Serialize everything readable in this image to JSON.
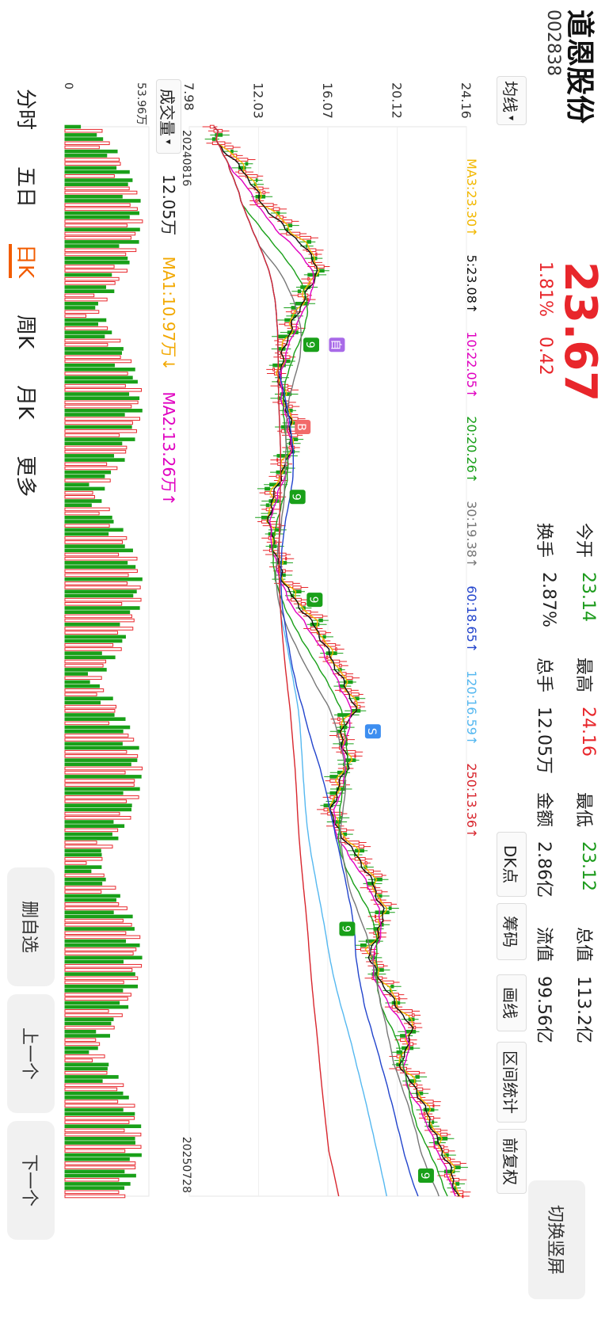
{
  "stock": {
    "name": "道恩股份",
    "code": "002838",
    "price": "23.67",
    "change_pct": "1.81%",
    "change": "0.42"
  },
  "stats": [
    {
      "label": "今开",
      "value": "23.14",
      "color": "green"
    },
    {
      "label": "最高",
      "value": "24.16",
      "color": "red"
    },
    {
      "label": "最低",
      "value": "23.12",
      "color": "green"
    },
    {
      "label": "总值",
      "value": "113.2亿",
      "color": "dark"
    },
    {
      "label": "换手",
      "value": "2.87%",
      "color": "dark"
    },
    {
      "label": "总手",
      "value": "12.05万",
      "color": "dark"
    },
    {
      "label": "金额",
      "value": "2.86亿",
      "color": "dark"
    },
    {
      "label": "流值",
      "value": "99.56亿",
      "color": "dark"
    }
  ],
  "switch_button": "切换竖屏",
  "controls": {
    "ma_select": "均线",
    "dk": "DK点",
    "chip": "筹码",
    "draw": "画线",
    "range": "区间统计",
    "adjust": "前复权"
  },
  "ma_legend": [
    {
      "text": "MA3:23.30↑",
      "color": "#f2b800"
    },
    {
      "text": "5:23.08↑",
      "color": "#111111"
    },
    {
      "text": "10:22.05↑",
      "color": "#e000c0"
    },
    {
      "text": "20:20.26↑",
      "color": "#19a019"
    },
    {
      "text": "30:19.38↑",
      "color": "#777777"
    },
    {
      "text": "60:18.65↑",
      "color": "#2244cc"
    },
    {
      "text": "120:16.59↑",
      "color": "#55b8f0"
    },
    {
      "text": "250:13.36↑",
      "color": "#d8262e"
    }
  ],
  "volume_bar": {
    "select": "成交量",
    "value": "12.05万",
    "ma1": "MA1:10.97万↓",
    "ma2": "MA2:13.26万↑",
    "ma1_color": "#f2a800",
    "ma2_color": "#e000c0"
  },
  "side_tabs": [
    "分时",
    "五日",
    "日K",
    "周K",
    "月K",
    "更多"
  ],
  "active_tab": "日K",
  "bottom_buttons": [
    "删自选",
    "上一个",
    "下一个"
  ],
  "colors": {
    "up": "#e8262b",
    "down": "#19a019",
    "accent": "#f25c00"
  },
  "chart_data": {
    "type": "candlestick",
    "y_ticks": [
      "24.16",
      "20.12",
      "16.07",
      "12.03",
      "7.98"
    ],
    "ylim": [
      7.98,
      24.16
    ],
    "x_start": "20240816",
    "x_end": "20250728",
    "volume_ticks": [
      "53.96万",
      "0"
    ],
    "close_path": [
      {
        "i": 0,
        "v": 9.2
      },
      {
        "i": 10,
        "v": 11.4
      },
      {
        "i": 18,
        "v": 12.4
      },
      {
        "i": 25,
        "v": 14.2
      },
      {
        "i": 32,
        "v": 15.6
      },
      {
        "i": 38,
        "v": 14.9
      },
      {
        "i": 45,
        "v": 14.1
      },
      {
        "i": 52,
        "v": 13.5
      },
      {
        "i": 60,
        "v": 13.2
      },
      {
        "i": 68,
        "v": 13.8
      },
      {
        "i": 76,
        "v": 14.0
      },
      {
        "i": 84,
        "v": 13.2
      },
      {
        "i": 92,
        "v": 12.6
      },
      {
        "i": 100,
        "v": 12.9
      },
      {
        "i": 110,
        "v": 13.6
      },
      {
        "i": 120,
        "v": 15.4
      },
      {
        "i": 130,
        "v": 16.6
      },
      {
        "i": 140,
        "v": 17.8
      },
      {
        "i": 146,
        "v": 16.6
      },
      {
        "i": 152,
        "v": 17.4
      },
      {
        "i": 158,
        "v": 16.7
      },
      {
        "i": 166,
        "v": 16.2
      },
      {
        "i": 172,
        "v": 17.2
      },
      {
        "i": 180,
        "v": 18.5
      },
      {
        "i": 190,
        "v": 19.4
      },
      {
        "i": 200,
        "v": 18.4
      },
      {
        "i": 208,
        "v": 19.5
      },
      {
        "i": 218,
        "v": 21.1
      },
      {
        "i": 226,
        "v": 20.2
      },
      {
        "i": 234,
        "v": 21.5
      },
      {
        "i": 244,
        "v": 22.4
      },
      {
        "i": 252,
        "v": 23.3
      },
      {
        "i": 260,
        "v": 23.67
      }
    ],
    "markers": [
      {
        "label": "自",
        "i": 53,
        "v": 16.6
      },
      {
        "label": "B",
        "i": 73,
        "v": 14.6
      },
      {
        "label": "S",
        "i": 147,
        "v": 18.7
      },
      {
        "label": "9",
        "i": 53,
        "v": 15.1
      },
      {
        "label": "9",
        "i": 90,
        "v": 14.3
      },
      {
        "label": "9",
        "i": 115,
        "v": 15.3
      },
      {
        "label": "9",
        "i": 195,
        "v": 17.2
      },
      {
        "label": "9",
        "i": 255,
        "v": 21.8
      }
    ],
    "volume_ticks_labels": [
      "53.96万",
      "0"
    ]
  }
}
